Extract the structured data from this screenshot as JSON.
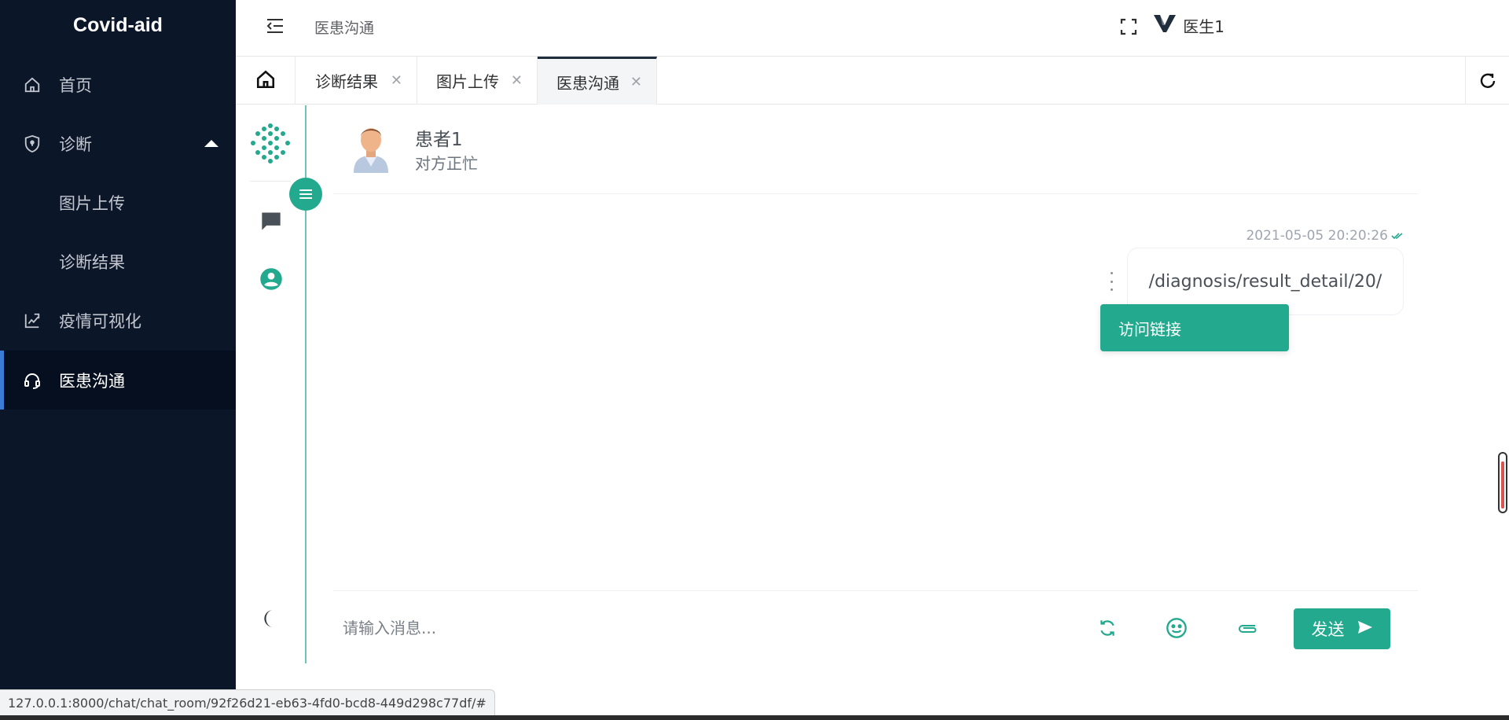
{
  "sidebar": {
    "brand": "Covid-aid",
    "items": [
      {
        "label": "首页",
        "icon": "home-icon"
      },
      {
        "label": "诊断",
        "icon": "shield-icon"
      },
      {
        "label": "图片上传"
      },
      {
        "label": "诊断结果"
      },
      {
        "label": "疫情可视化",
        "icon": "chart-icon"
      },
      {
        "label": "医患沟通",
        "icon": "headset-icon",
        "active": true
      }
    ]
  },
  "header": {
    "breadcrumb": "医患沟通",
    "user": "医生1"
  },
  "tabs": [
    {
      "label": "诊断结果"
    },
    {
      "label": "图片上传"
    },
    {
      "label": "医患沟通",
      "active": true
    }
  ],
  "chat": {
    "contact_name": "患者1",
    "contact_status": "对方正忙",
    "messages": [
      {
        "time": "2021-05-05 20:20:26",
        "text": "/diagnosis/result_detail/20/",
        "outgoing": true
      }
    ],
    "context_menu": {
      "item": "访问链接"
    },
    "input_placeholder": "请输入消息...",
    "send_label": "发送"
  },
  "status_url": "127.0.0.1:8000/chat/chat_room/92f26d21-eb63-4fd0-bcd8-449d298c77df/#",
  "colors": {
    "sidebar_bg": "#0c1629",
    "accent": "#23a98e",
    "active_indicator": "#3a7bd5"
  }
}
